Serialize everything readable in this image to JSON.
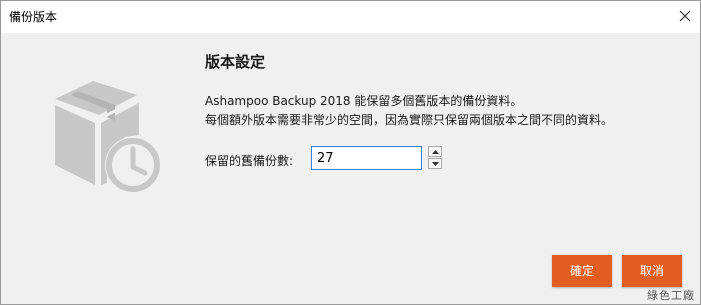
{
  "window": {
    "title": "備份版本"
  },
  "content": {
    "heading": "版本設定",
    "description_line1": "Ashampoo Backup 2018 能保留多個舊版本的備份資料。",
    "description_line2": "每個額外版本需要非常少的空間，因為實際只保留兩個版本之間不同的資料。",
    "field_label": "保留的舊備份數:",
    "field_value": "27"
  },
  "buttons": {
    "ok_label": "確定",
    "cancel_label": "取消"
  },
  "watermark": {
    "text": "綠色工廠"
  },
  "icons": {
    "close": "close-icon",
    "illustration": "box-clock-icon",
    "spin_up": "arrow-up-icon",
    "spin_down": "arrow-down-icon"
  },
  "colors": {
    "accent": "#e35e21",
    "focus_border": "#3c7fd4",
    "illustration": "#c8c8c8"
  }
}
